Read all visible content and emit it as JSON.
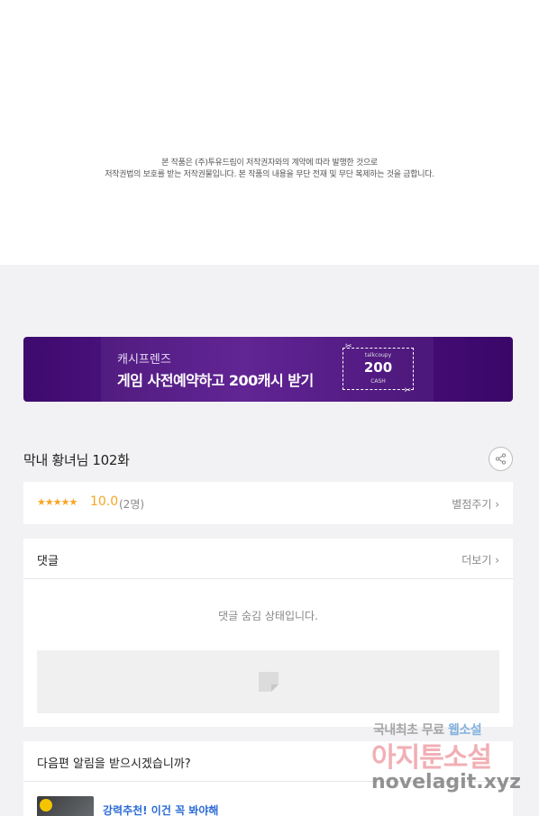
{
  "notice": {
    "line1": "본 작품은 (주)투유드림이 저작권자와의 계약에 따라 발행한 것으로",
    "line2": "저작권법의 보호를 받는 저작권물입니다. 본 작품의 내용을 무단 전재 및 무단 복제하는 것을 금합니다."
  },
  "banner": {
    "brand": "캐시프렌즈",
    "title": "게임 사전예약하고 200캐시 받기",
    "coupon_small": "talkcoupy",
    "coupon_amount": "200",
    "coupon_unit": "CASH"
  },
  "episode": {
    "title": "막내 황녀님 102화",
    "share_icon": "share-icon"
  },
  "rating": {
    "stars": "★★★★★",
    "score": "10.0",
    "count": "(2명)",
    "rate_label": "별점주기 ›"
  },
  "comments": {
    "title": "댓글",
    "more_label": "더보기 ›",
    "hidden_message": "댓글 숨김 상태입니다."
  },
  "next_episode": {
    "question": "다음편 알림을 받으시겠습니까?",
    "recommend_text": "강력추천! 이건 꼭 봐야해"
  },
  "watermark": {
    "line1_a": "국내최초 무료",
    "line1_b": "웹소설",
    "line2": "아지툰소설",
    "line3": "novelagit.xyz"
  },
  "colors": {
    "banner_purple": "#4a0f7d",
    "star_orange": "#f5a623",
    "link_blue": "#2a6bd6"
  }
}
